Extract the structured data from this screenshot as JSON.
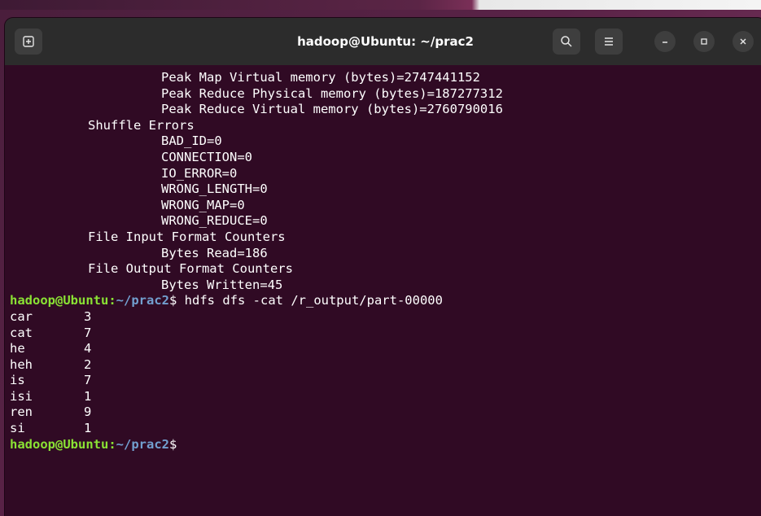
{
  "window": {
    "title": "hadoop@Ubuntu: ~/prac2",
    "buttons": {
      "new_tab_icon": "new-tab-icon",
      "search_icon": "search-icon",
      "menu_icon": "hamburger-menu-icon",
      "minimize_icon": "minimize-icon",
      "maximize_icon": "maximize-icon",
      "close_icon": "close-icon"
    }
  },
  "terminal": {
    "counters": [
      {
        "indent": 2,
        "text": "Peak Map Virtual memory (bytes)=2747441152"
      },
      {
        "indent": 2,
        "text": "Peak Reduce Physical memory (bytes)=187277312"
      },
      {
        "indent": 2,
        "text": "Peak Reduce Virtual memory (bytes)=2760790016"
      },
      {
        "indent": 1,
        "text": "Shuffle Errors"
      },
      {
        "indent": 2,
        "text": "BAD_ID=0"
      },
      {
        "indent": 2,
        "text": "CONNECTION=0"
      },
      {
        "indent": 2,
        "text": "IO_ERROR=0"
      },
      {
        "indent": 2,
        "text": "WRONG_LENGTH=0"
      },
      {
        "indent": 2,
        "text": "WRONG_MAP=0"
      },
      {
        "indent": 2,
        "text": "WRONG_REDUCE=0"
      },
      {
        "indent": 1,
        "text": "File Input Format Counters"
      },
      {
        "indent": 2,
        "text": "Bytes Read=186"
      },
      {
        "indent": 1,
        "text": "File Output Format Counters"
      },
      {
        "indent": 2,
        "text": "Bytes Written=45"
      }
    ],
    "prompt": {
      "user_host": "hadoop@Ubuntu",
      "colon": ":",
      "path": "~/prac2",
      "symbol": "$"
    },
    "command": " hdfs dfs -cat /r_output/part-00000",
    "output": [
      {
        "word": "car",
        "count": "3"
      },
      {
        "word": "cat",
        "count": "7"
      },
      {
        "word": "he",
        "count": "4"
      },
      {
        "word": "heh",
        "count": "2"
      },
      {
        "word": "is",
        "count": "7"
      },
      {
        "word": "isi",
        "count": "1"
      },
      {
        "word": "ren",
        "count": "9"
      },
      {
        "word": "si",
        "count": "1"
      }
    ]
  },
  "colors": {
    "terminal_bg": "#300a24",
    "titlebar_bg": "#2c2c2c",
    "prompt_user": "#8ae234",
    "prompt_path": "#729fcf",
    "text": "#ffffff"
  }
}
